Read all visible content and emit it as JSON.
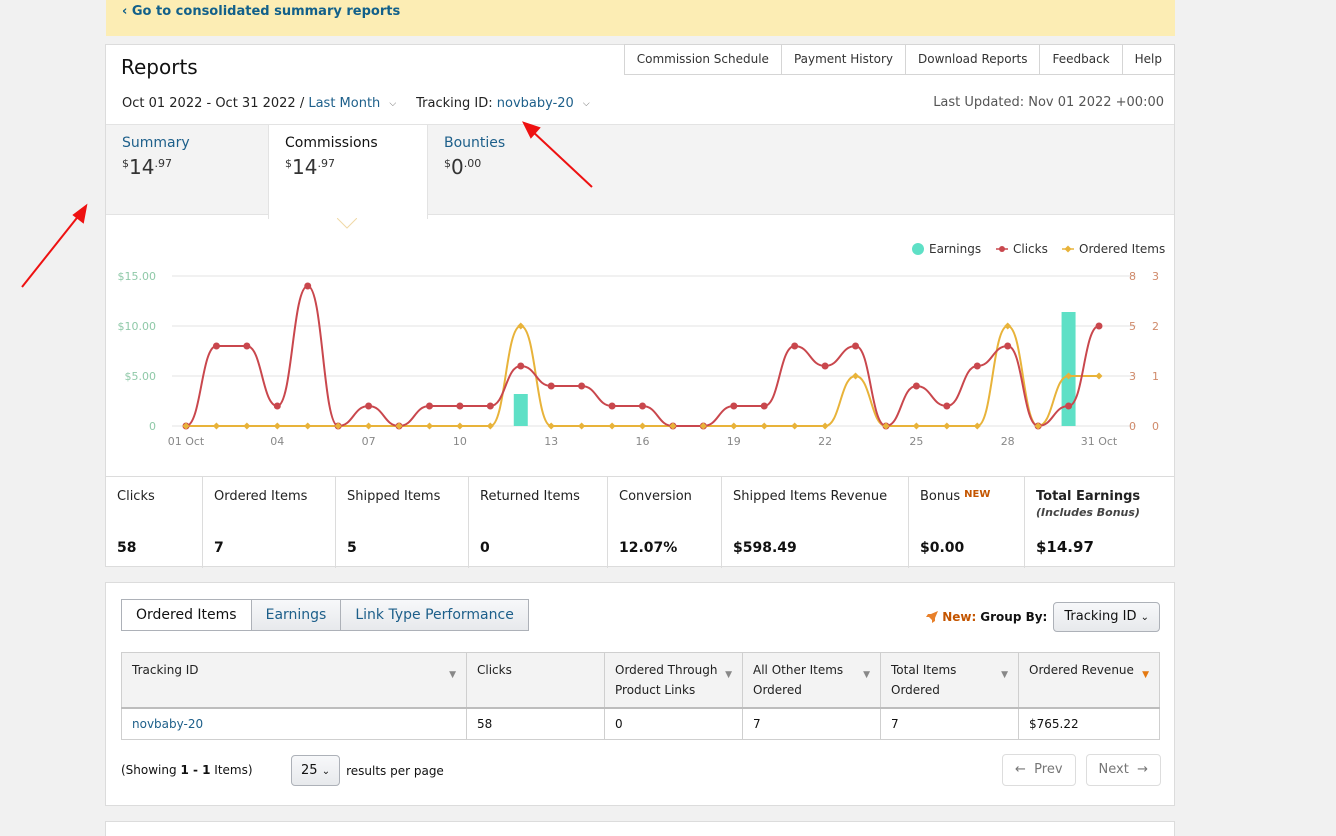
{
  "banner": {
    "link": "‹ Go to consolidated summary reports"
  },
  "header": {
    "title": "Reports",
    "nav": [
      "Commission Schedule",
      "Payment History",
      "Download Reports",
      "Feedback",
      "Help"
    ],
    "date_range": "Oct 01 2022 - Oct 31 2022 /",
    "period": "Last Month",
    "tracking_label": "Tracking ID:",
    "tracking_id": "novbaby-20",
    "last_updated": "Last Updated: Nov 01 2022 +00:00"
  },
  "tabs": [
    {
      "name": "Summary",
      "cur": "$",
      "whole": "14",
      "frac": ".97"
    },
    {
      "name": "Commissions",
      "cur": "$",
      "whole": "14",
      "frac": ".97"
    },
    {
      "name": "Bounties",
      "cur": "$",
      "whole": "0",
      "frac": ".00"
    }
  ],
  "chart_data": {
    "type": "line",
    "legend": [
      "Earnings",
      "Clicks",
      "Ordered Items"
    ],
    "colors": {
      "earnings": "#5ee0c6",
      "clicks": "#c9474d",
      "ordered": "#e8b33a"
    },
    "x_ticks": [
      "01 Oct",
      "04",
      "07",
      "10",
      "13",
      "16",
      "19",
      "22",
      "25",
      "28",
      "31 Oct"
    ],
    "y_left_ticks": [
      "$15.00",
      "$10.00",
      "$5.00",
      "0"
    ],
    "y_clicks_ticks": [
      "8",
      "5",
      "3",
      "0"
    ],
    "y_items_ticks": [
      "3",
      "2",
      "1",
      "0"
    ],
    "days": [
      1,
      2,
      3,
      4,
      5,
      6,
      7,
      8,
      9,
      10,
      11,
      12,
      13,
      14,
      15,
      16,
      17,
      18,
      19,
      20,
      21,
      22,
      23,
      24,
      25,
      26,
      27,
      28,
      29,
      30,
      31
    ],
    "clicks": [
      0,
      4,
      4,
      1,
      7,
      0,
      1,
      0,
      1,
      1,
      1,
      3,
      2,
      2,
      1,
      1,
      0,
      0,
      1,
      1,
      4,
      3,
      4,
      0,
      2,
      1,
      3,
      4,
      0,
      1,
      5
    ],
    "ordered_items": [
      0,
      0,
      0,
      0,
      0,
      0,
      0,
      0,
      0,
      0,
      0,
      2,
      0,
      0,
      0,
      0,
      0,
      0,
      0,
      0,
      0,
      0,
      1,
      0,
      0,
      0,
      0,
      2,
      0,
      1,
      1
    ],
    "earnings": [
      0,
      0,
      0,
      0,
      0,
      0,
      0,
      0,
      0,
      0,
      0,
      3.2,
      0,
      0,
      0,
      0,
      0,
      0,
      0,
      0,
      0,
      0,
      0,
      0,
      0,
      0,
      0,
      0,
      0,
      11.4,
      0
    ],
    "ylim_earnings": [
      0,
      15
    ],
    "ylim_clicks": [
      0,
      7.5
    ],
    "ylim_items": [
      0,
      3
    ]
  },
  "stats": [
    {
      "label": "Clicks",
      "value": "58"
    },
    {
      "label": "Ordered Items",
      "value": "7"
    },
    {
      "label": "Shipped Items",
      "value": "5"
    },
    {
      "label": "Returned Items",
      "value": "0"
    },
    {
      "label": "Conversion",
      "value": "12.07%"
    },
    {
      "label": "Shipped Items Revenue",
      "value": "$598.49"
    },
    {
      "label": "Bonus",
      "badge": "NEW",
      "value": "$0.00"
    },
    {
      "label": "Total Earnings",
      "sub": "(Includes Bonus)",
      "value": "$14.97"
    }
  ],
  "report_table": {
    "tabs": [
      "Ordered Items",
      "Earnings",
      "Link Type Performance"
    ],
    "new_label": "New:",
    "group_by_label": "Group By:",
    "group_by_value": "Tracking ID",
    "columns": [
      "Tracking ID",
      "Clicks",
      "Ordered Through Product Links",
      "All Other Items Ordered",
      "Total Items Ordered",
      "Ordered Revenue"
    ],
    "rows": [
      [
        "novbaby-20",
        "58",
        "0",
        "7",
        "7",
        "$765.22"
      ]
    ],
    "showing_pre": "(Showing ",
    "showing_range": "1 - 1",
    "showing_post": " Items)",
    "per_page_value": "25",
    "per_page_label": "results per page",
    "prev": "Prev",
    "next": "Next"
  }
}
